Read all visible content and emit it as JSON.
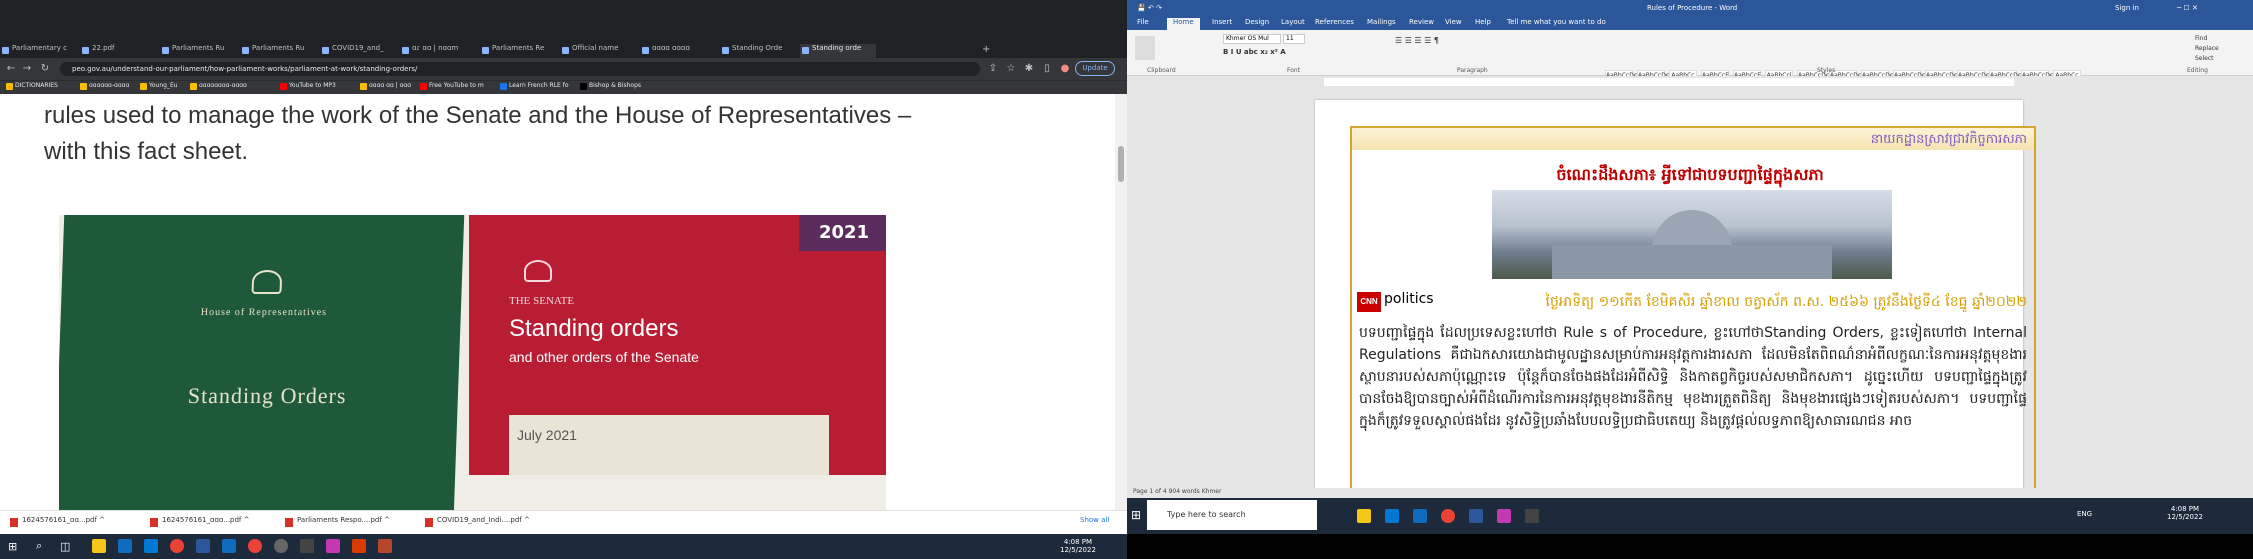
{
  "browser": {
    "tabs": [
      "Parliamentary c",
      "22.pdf",
      "Parliaments Ru",
      "Parliaments Ru",
      "COVID19_and_",
      "ɑɾ ɑɑ | nɑɑm",
      "Parliaments Re",
      "Official name",
      "ɑɑɑɑ ɑɑɑɑ",
      "Standing Orde",
      "Standing orde"
    ],
    "url": "peo.gov.au/understand-our-parliament/how-parliament-works/parliament-at-work/standing-orders/",
    "update_label": "Update",
    "bookmarks": [
      "DICTIONARIES",
      "ɑɑɑɑɑɑ-ɑɑɑɑ",
      "Young_Eu",
      "ɑɑɑɑɑɑɑɑ-ɑɑɑɑ",
      "YouTube to MP3",
      "ɑɑɑɑ ɑɑ | ɑɑɑ",
      "Free YouTube to m",
      "Learn French RLE fo",
      "Bishop & Bishops"
    ],
    "intro_text": "rules used to manage the work of the Senate and the House of Representatives – with this fact sheet.",
    "image": {
      "green_book_small": "House of Representatives",
      "green_book_title": "Standing Orders",
      "red_book_small": "THE SENATE",
      "red_book_title": "Standing orders",
      "red_book_sub": "and other orders of the Senate",
      "red_book_date": "July 2021",
      "year_badge": "2021"
    },
    "downloads": [
      "1624576161_ɑɑ...pdf",
      "1624576161_ɑɑɑ...pdf",
      "Parliaments Respo....pdf",
      "COVID19_and_Indi....pdf"
    ],
    "show_all": "Show all"
  },
  "word": {
    "title": "Rules of Procedure - Word",
    "signin": "Sign in",
    "tabs": [
      "File",
      "Home",
      "Insert",
      "Design",
      "Layout",
      "References",
      "Mailings",
      "Review",
      "View",
      "Help",
      "Tell me what you want to do"
    ],
    "font_name": "Khmer OS Mul",
    "font_size": "11",
    "group_labels": [
      "Clipboard",
      "Font",
      "Paragraph",
      "Styles",
      "Editing"
    ],
    "styles": [
      "AaBbCcDc",
      "AaBbCcDc",
      "AaBbCc",
      "AaBbCcE",
      "AaBbCcE",
      "AaBbCcl",
      "AaBbCcDc",
      "AaBbCcDc",
      "AaBbCcDc",
      "AaBbCcDc",
      "AaBbCcDc",
      "AaBbCcDc",
      "AaBbCcDc",
      "AaBbCcDc",
      "AaBbCc"
    ],
    "editing": [
      "Find",
      "Replace",
      "Select"
    ],
    "header_text": "នាយកដ្ឋានស្រាវជ្រាវកិច្ចការសភា",
    "headline": "ចំណេះដឹងសភា៖ អ្វីទៅជាបទបញ្ជាផ្ទៃក្នុងសភា",
    "cnn": "CNN",
    "politics": "politics",
    "dateline": "ថ្ងៃអាទិត្យ ១១កើត ខែមិគសិរ ឆ្នាំខាល ចត្វាស័ក ព.ស. ២៥៦៦ ត្រូវនឹងថ្ងៃទី៤ ខែធ្នូ ឆ្នាំ២០២២",
    "body": "បទបញ្ជាផ្ទៃក្នុង ដែលប្រទេសខ្លះហៅថា Rule s of Procedure, ខ្លះហៅថាStanding Orders, ខ្លះទៀតហៅថា Internal Regulations គឺជាឯកសារយោងជាមូលដ្ឋានសម្រាប់ការអនុវត្តការងារសភា ដែលមិនតែពិពណ៌នាអំពីលក្ខណៈនៃការអនុវត្តមុខងារស្ថាបនារបស់សភាប៉ុណ្ណោះទេ ប៉ុន្តែក៏បានចែងផងដែរអំពីសិទ្ធិ និងកាតព្វកិច្ចរបស់សមាជិកសភា។ ដូច្នេះហើយ បទបញ្ជាផ្ទៃក្នុងត្រូវបានចែងឱ្យបានច្បាស់អំពីដំណើរការនៃការអនុវត្តមុខងារនីតិកម្ម មុខងារត្រួតពិនិត្យ និងមុខងារផ្សេងៗទៀតរបស់សភា។ បទបញ្ជាផ្ទៃក្នុងក៏ត្រូវទទួលស្គាល់ផងដែរ នូវសិទ្ធិប្រឆាំងបែបលទ្ធិប្រជាធិបតេយ្យ និងត្រូវផ្ដល់លទ្ធភាពឱ្យសាធារណជន អាច",
    "status": "Page 1 of 4    904 words    Khmer",
    "search_placeholder": "Type here to search",
    "clock_time": "4:08 PM",
    "clock_date": "12/5/2022",
    "lang": "ENG"
  },
  "left_clock": {
    "time": "4:08 PM",
    "date": "12/5/2022"
  }
}
